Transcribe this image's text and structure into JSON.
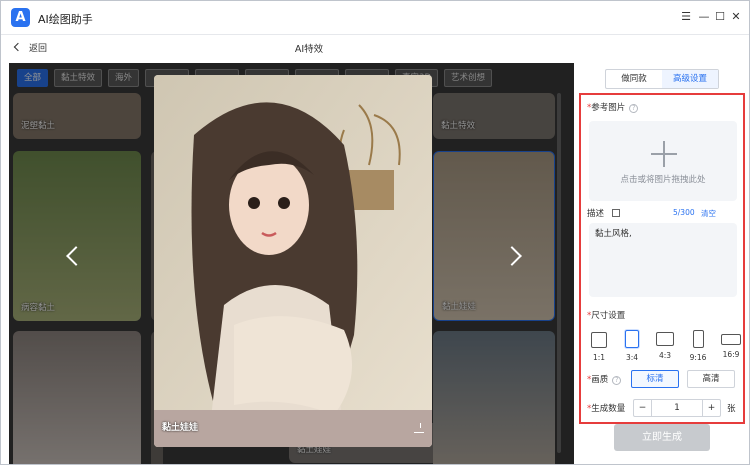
{
  "app": {
    "logo_letter": "A",
    "title": "AI绘图助手"
  },
  "window_controls": {
    "menu": "☰",
    "minimize": "—",
    "maximize": "☐",
    "close": "✕"
  },
  "nav": {
    "back_label": "返回",
    "page_title": "AI特效"
  },
  "categories": {
    "all": "全部",
    "clay": "黏土特效",
    "overseas": "海外",
    "real3d": "真实3D",
    "art": "艺术创想"
  },
  "gallery": {
    "card1": "泥塑黏土",
    "card2": "黏土特效",
    "card3": "病容黏土",
    "card4": "黏土娃娃",
    "card5": "黏土娃娃",
    "preview_caption": "黏土娃娃"
  },
  "settings": {
    "tabs": {
      "same": "做同款",
      "advanced": "高级设置"
    },
    "ref_label": "参考图片",
    "upload_hint": "点击或将图片拖拽此处",
    "desc_label": "描述",
    "desc_count": "5/300",
    "clear": "清空",
    "desc_text": "黏土风格,",
    "size_label": "尺寸设置",
    "sizes": [
      "1:1",
      "3:4",
      "4:3",
      "9:16",
      "16:9"
    ],
    "quality_label": "画质",
    "quality": {
      "standard": "标清",
      "hd": "高清"
    },
    "count_label": "生成数量",
    "count_minus": "−",
    "count_value": "1",
    "count_plus": "+",
    "count_unit": "张",
    "generate": "立即生成"
  },
  "colors": {
    "accent": "#2a72f0",
    "highlight": "#e63c3c"
  }
}
